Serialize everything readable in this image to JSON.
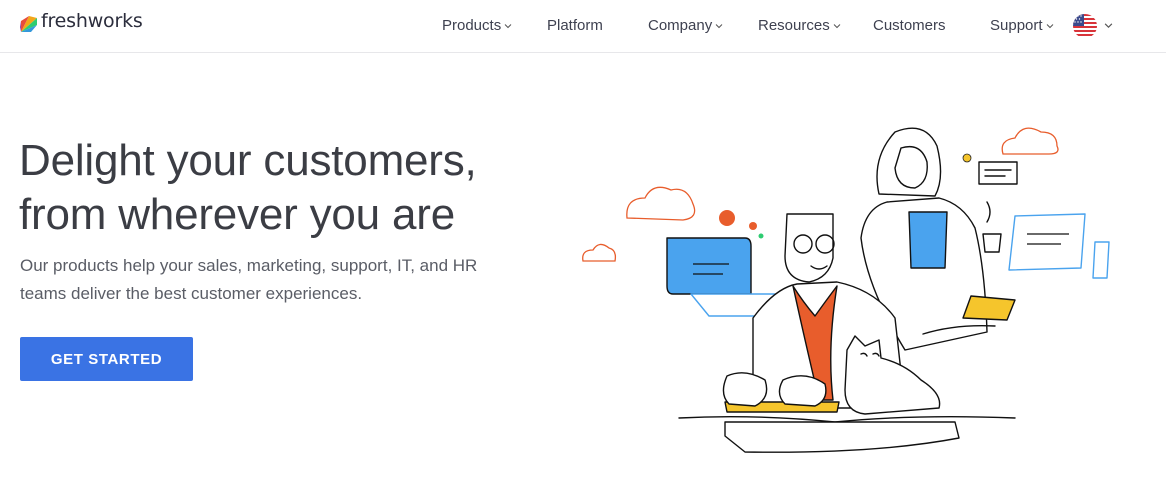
{
  "brand": {
    "name": "freshworks",
    "logo_colors": [
      "#f3a71a",
      "#e74c3c",
      "#8e44ad",
      "#3498db",
      "#2ecc71"
    ]
  },
  "nav": {
    "items": [
      {
        "label": "Products",
        "has_dropdown": true
      },
      {
        "label": "Platform",
        "has_dropdown": false
      },
      {
        "label": "Company",
        "has_dropdown": true
      },
      {
        "label": "Resources",
        "has_dropdown": true
      },
      {
        "label": "Customers",
        "has_dropdown": false
      },
      {
        "label": "Support",
        "has_dropdown": true
      }
    ],
    "region_icon": "us-flag-icon"
  },
  "hero": {
    "title_line1": "Delight your customers,",
    "title_line2": "from wherever you are",
    "subtitle_line1": "Our products help your sales, marketing, support, IT, and HR",
    "subtitle_line2": "teams deliver the best customer experiences.",
    "cta_label": "GET STARTED"
  },
  "colors": {
    "accent": "#3a73e4",
    "illustration_orange": "#e85d2c",
    "illustration_blue": "#4aa3ee",
    "illustration_yellow": "#f5c52c"
  }
}
